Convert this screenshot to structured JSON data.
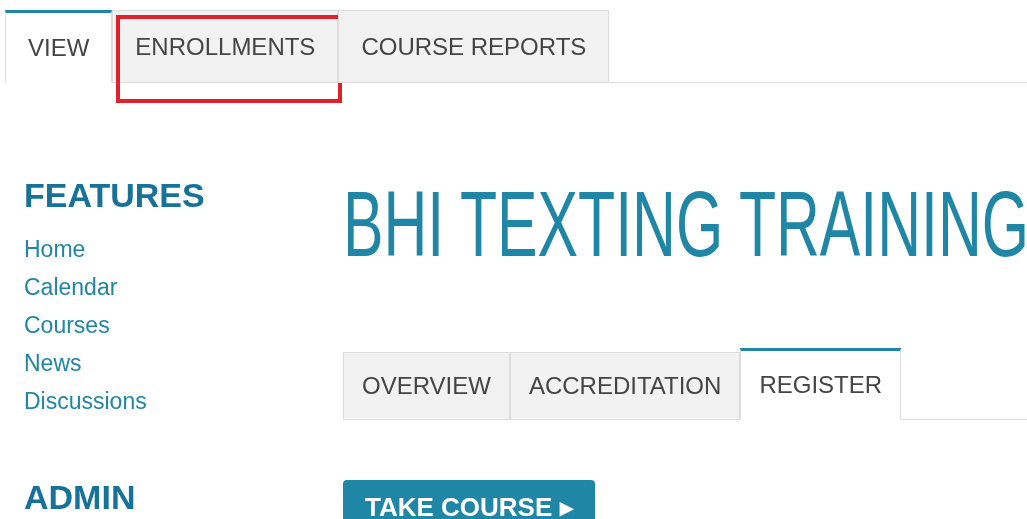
{
  "top_tabs": [
    {
      "label": "VIEW",
      "selected": true,
      "highlighted": false
    },
    {
      "label": "ENROLLMENTS",
      "selected": false,
      "highlighted": true
    },
    {
      "label": "COURSE REPORTS",
      "selected": false,
      "highlighted": false
    }
  ],
  "sidebar": {
    "sections": [
      {
        "heading": "FEATURES",
        "items": [
          "Home",
          "Calendar",
          "Courses",
          "News",
          "Discussions"
        ]
      },
      {
        "heading": "ADMIN"
      }
    ]
  },
  "course": {
    "title": "BHI TEXTING TRAINING",
    "tabs": [
      {
        "label": "OVERVIEW",
        "selected": false
      },
      {
        "label": "ACCREDITATION",
        "selected": false
      },
      {
        "label": "REGISTER",
        "selected": true
      }
    ],
    "action": {
      "label": "TAKE COURSE",
      "glyph": "▸"
    }
  }
}
